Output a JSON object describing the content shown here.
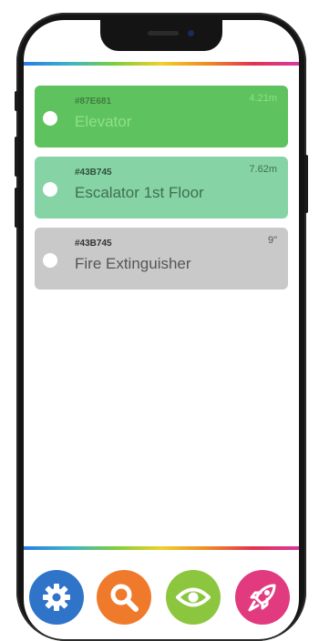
{
  "items": [
    {
      "code": "#87E681",
      "distance": "4.21m",
      "name": "Elevator",
      "bg": "#5ec25e",
      "text": "#8fe08a",
      "code_color": "#3f7f3f"
    },
    {
      "code": "#43B745",
      "distance": "7.62m",
      "name": "Escalator 1st Floor",
      "bg": "#86d4a6",
      "text": "#3f6e52",
      "code_color": "#2f4f3a"
    },
    {
      "code": "#43B745",
      "distance": "9\"",
      "name": "Fire Extinguisher",
      "bg": "#c9c9c9",
      "text": "#555555",
      "code_color": "#333333"
    }
  ],
  "nav": [
    {
      "icon": "gear-icon",
      "color": "#2f74c9"
    },
    {
      "icon": "search-icon",
      "color": "#f07a2c"
    },
    {
      "icon": "eye-icon",
      "color": "#8cc63f"
    },
    {
      "icon": "rocket-icon",
      "color": "#e23a7e"
    }
  ]
}
